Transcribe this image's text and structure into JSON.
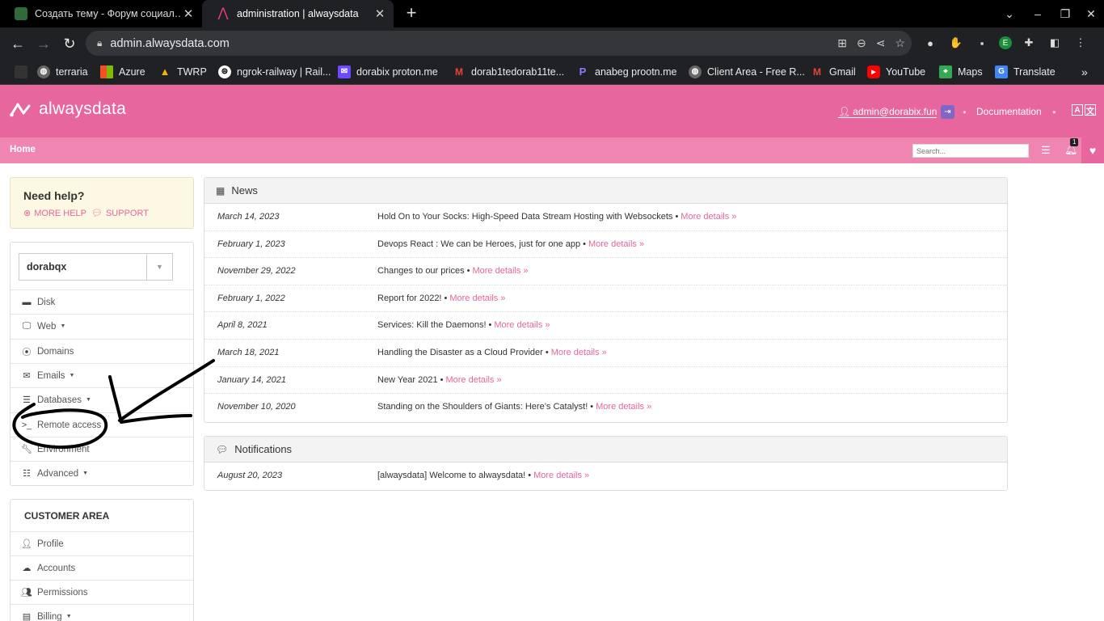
{
  "browser": {
    "tabs": [
      {
        "title": "Создать тему - Форум социал…",
        "active": false
      },
      {
        "title": "administration | alwaysdata",
        "active": true
      }
    ],
    "url": "admin.alwaysdata.com",
    "bookmarks": [
      "terraria",
      "Azure",
      "TWRP",
      "ngrok-railway | Rail...",
      "dorabix proton.me",
      "dorab1tedorab11te...",
      "anabeg prootn.me",
      "Client Area - Free R...",
      "Gmail",
      "YouTube",
      "Maps",
      "Translate"
    ]
  },
  "header": {
    "logo_text": "alwaysdata",
    "user": "admin@dorabix.fun",
    "documentation": "Documentation",
    "brand_color": "#e6669d"
  },
  "subnav": {
    "home": "Home",
    "search_placeholder": "Search...",
    "notification_count": "1"
  },
  "help": {
    "title": "Need help?",
    "more_help": "MORE HELP",
    "support": "SUPPORT"
  },
  "account": {
    "selected": "dorabqx",
    "menu": [
      {
        "label": "Disk",
        "icon": "disk-icon",
        "dropdown": false
      },
      {
        "label": "Web",
        "icon": "monitor-icon",
        "dropdown": true
      },
      {
        "label": "Domains",
        "icon": "globe-icon",
        "dropdown": false
      },
      {
        "label": "Emails",
        "icon": "envelope-icon",
        "dropdown": true
      },
      {
        "label": "Databases",
        "icon": "database-icon",
        "dropdown": true
      },
      {
        "label": "Remote access",
        "icon": "terminal-icon",
        "dropdown": false
      },
      {
        "label": "Environment",
        "icon": "wrench-icon",
        "dropdown": false
      },
      {
        "label": "Advanced",
        "icon": "server-icon",
        "dropdown": true
      }
    ]
  },
  "customer_area": {
    "title": "CUSTOMER AREA",
    "menu": [
      {
        "label": "Profile",
        "icon": "user-icon",
        "dropdown": false
      },
      {
        "label": "Accounts",
        "icon": "cloud-icon",
        "dropdown": false
      },
      {
        "label": "Permissions",
        "icon": "users-icon",
        "dropdown": false
      },
      {
        "label": "Billing",
        "icon": "billing-icon",
        "dropdown": true
      }
    ]
  },
  "news": {
    "title": "News",
    "more_label": "More details »",
    "items": [
      {
        "date": "March 14, 2023",
        "text": "Hold On to Your Socks: High-Speed Data Stream Hosting with Websockets"
      },
      {
        "date": "February 1, 2023",
        "text": "Devops React : We can be Heroes, just for one app"
      },
      {
        "date": "November 29, 2022",
        "text": "Changes to our prices"
      },
      {
        "date": "February 1, 2022",
        "text": "Report for 2022!"
      },
      {
        "date": "April 8, 2021",
        "text": "Services: Kill the Daemons!"
      },
      {
        "date": "March 18, 2021",
        "text": "Handling the Disaster as a Cloud Provider"
      },
      {
        "date": "January 14, 2021",
        "text": "New Year 2021"
      },
      {
        "date": "November 10, 2020",
        "text": "Standing on the Shoulders of Giants: Here’s Catalyst!"
      }
    ]
  },
  "notifications": {
    "title": "Notifications",
    "more_label": "More details »",
    "items": [
      {
        "date": "August 20, 2023",
        "text": "[alwaysdata] Welcome to alwaysdata!"
      }
    ]
  }
}
